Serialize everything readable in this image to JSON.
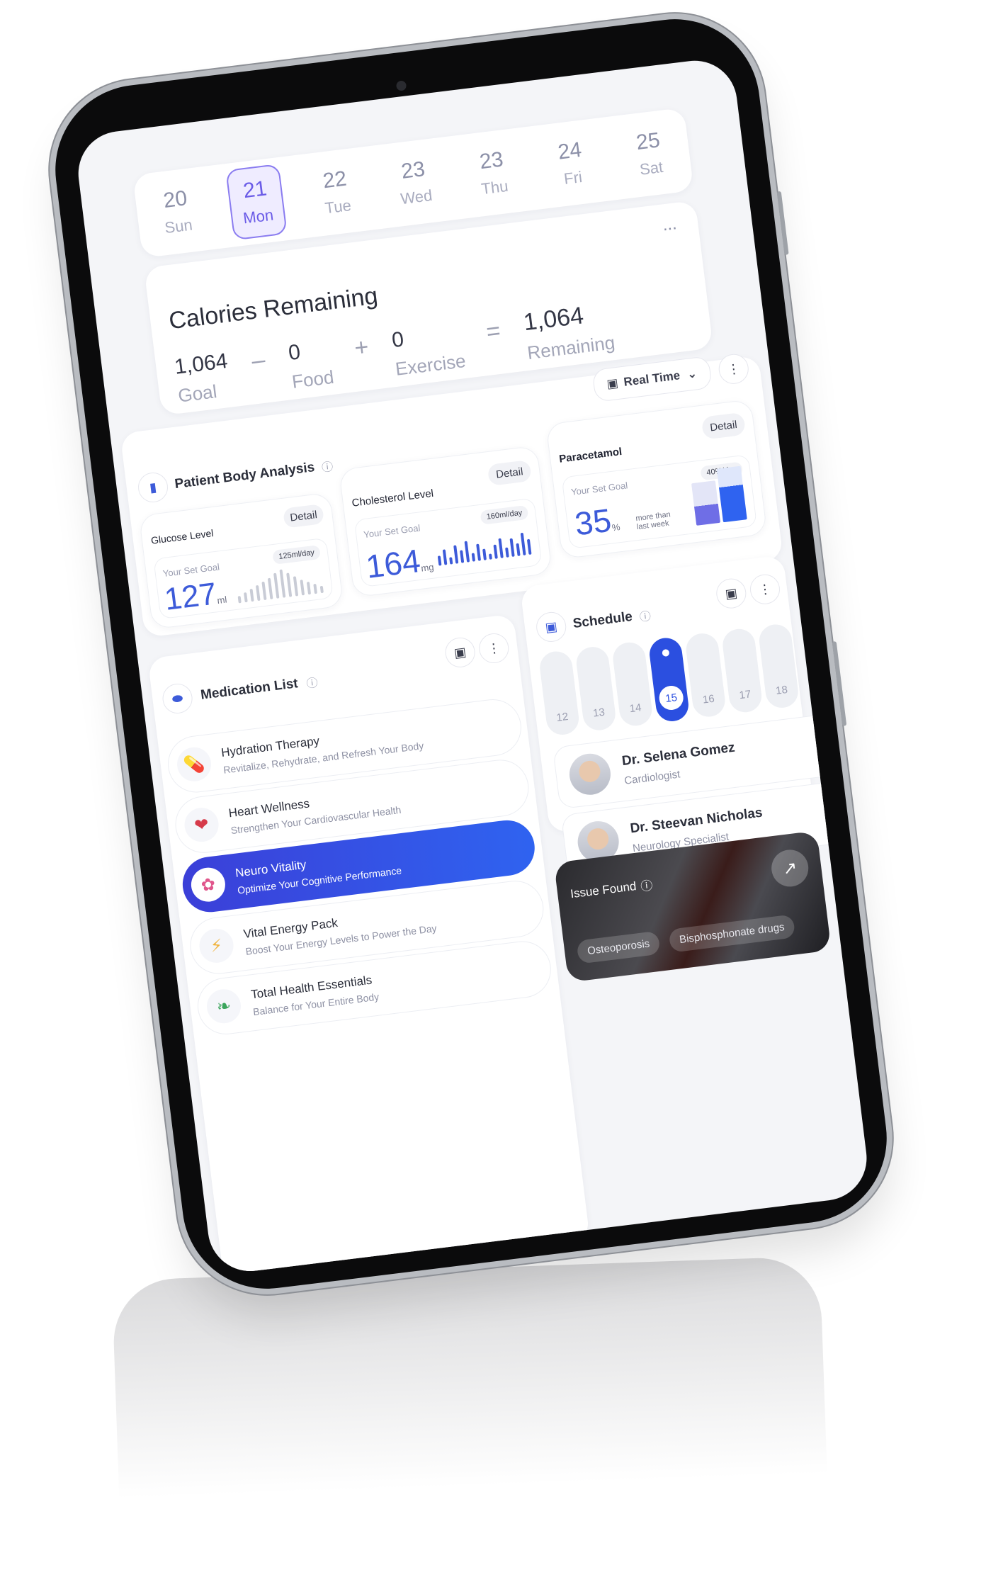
{
  "dates": [
    {
      "num": "20",
      "day": "Sun",
      "active": false
    },
    {
      "num": "21",
      "day": "Mon",
      "active": true
    },
    {
      "num": "22",
      "day": "Tue",
      "active": false
    },
    {
      "num": "23",
      "day": "Wed",
      "active": false
    },
    {
      "num": "23",
      "day": "Thu",
      "active": false
    },
    {
      "num": "24",
      "day": "Fri",
      "active": false
    },
    {
      "num": "25",
      "day": "Sat",
      "active": false
    }
  ],
  "calories": {
    "title": "Calories Remaining",
    "more": "...",
    "goal_value": "1,064",
    "goal_label": "Goal",
    "minus": "–",
    "food_value": "0",
    "food_label": "Food",
    "plus": "+",
    "exercise_value": "0",
    "exercise_label": "Exercise",
    "equals": "=",
    "remaining_value": "1,064",
    "remaining_label": "Remaining"
  },
  "analysis": {
    "realtime_label": "Real Time",
    "title": "Patient Body Analysis",
    "glucose": {
      "title": "Glucose Level",
      "detail": "Detail",
      "goal_label": "Your Set Goal",
      "rate": "125ml/day",
      "value": "127",
      "unit": "ml"
    },
    "cholesterol": {
      "title": "Cholesterol Level",
      "detail": "Detail",
      "goal_label": "Your Set Goal",
      "rate": "160ml/day",
      "value": "164",
      "unit": "mg"
    },
    "paracetamol": {
      "title": "Paracetamol",
      "detail": "Detail",
      "goal_label": "Your Set Goal",
      "rate": "40%/day",
      "value": "35",
      "unit": "%",
      "compare": "more than last week"
    }
  },
  "medication": {
    "title": "Medication List",
    "items": [
      {
        "title": "Hydration Therapy",
        "sub": "Revitalize, Rehydrate, and Refresh Your Body",
        "icon": "capsule-icon"
      },
      {
        "title": "Heart Wellness",
        "sub": "Strengthen Your Cardiovascular Health",
        "icon": "heart-icon"
      },
      {
        "title": "Neuro Vitality",
        "sub": "Optimize Your Cognitive Performance",
        "icon": "brain-icon"
      },
      {
        "title": "Vital Energy Pack",
        "sub": "Boost Your Energy Levels to Power the Day",
        "icon": "lightning-icon"
      },
      {
        "title": "Total Health Essentials",
        "sub": "Balance for Your Entire Body",
        "icon": "leaf-icon"
      }
    ]
  },
  "schedule": {
    "title": "Schedule",
    "days": [
      "12",
      "13",
      "14",
      "15",
      "16",
      "17",
      "18"
    ],
    "selected_day": "15",
    "doctors": [
      {
        "name": "Dr. Selena Gomez",
        "role": "Cardiologist"
      },
      {
        "name": "Dr. Steevan Nicholas",
        "role": "Neurology Specialist"
      }
    ]
  },
  "issue": {
    "title": "Issue Found",
    "tags": [
      "Osteoporosis",
      "Bisphosphonate drugs"
    ]
  },
  "colors": {
    "accent": "#2b4fe0",
    "purple": "#6b5ce7",
    "screen_bg": "#f4f5f8"
  }
}
